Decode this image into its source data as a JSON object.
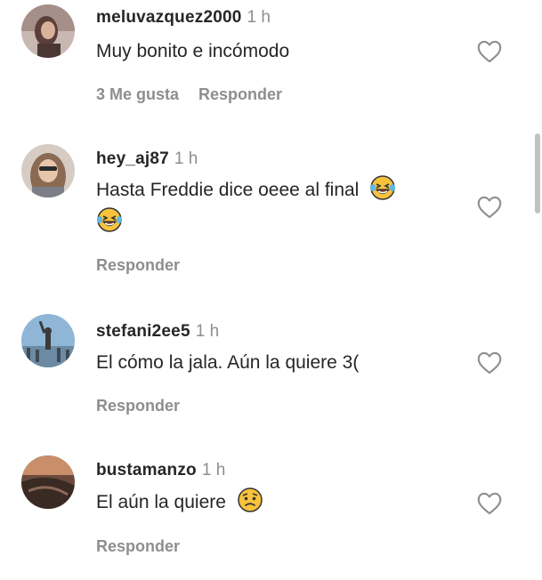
{
  "comments": [
    {
      "username": "meluvazquez2000",
      "time": "1 h",
      "text": "Muy bonito e incómodo",
      "likes": "3 Me gusta",
      "reply": "Responder"
    },
    {
      "username": "hey_aj87",
      "time": "1 h",
      "text": "Hasta Freddie dice oeee al final",
      "reply": "Responder",
      "emoji": [
        "laughing-tears-emoji",
        "laughing-tears-emoji"
      ]
    },
    {
      "username": "stefani2ee5",
      "time": "1 h",
      "text": "El cómo la jala. Aún la quiere 3(",
      "reply": "Responder"
    },
    {
      "username": "bustamanzo",
      "time": "1 h",
      "text": "El aún la quiere",
      "reply": "Responder",
      "emoji": [
        "worried-face-emoji"
      ]
    }
  ],
  "icons": {
    "like": "heart-outline-icon"
  },
  "colors": {
    "text": "#262626",
    "muted": "#8e8e8e",
    "emoji": "#f7c33c"
  }
}
